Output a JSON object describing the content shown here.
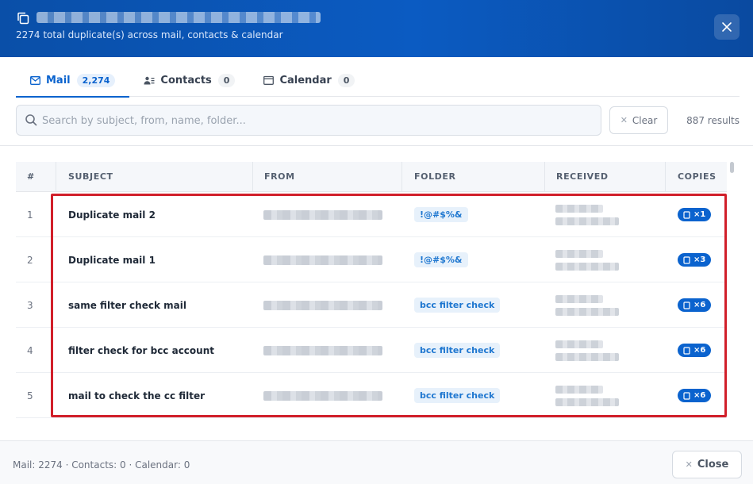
{
  "header": {
    "subtitle": "2274 total duplicate(s) across mail, contacts & calendar"
  },
  "tabs": [
    {
      "label": "Mail",
      "count": "2,274",
      "icon": "mail-icon"
    },
    {
      "label": "Contacts",
      "count": "0",
      "icon": "contacts-icon"
    },
    {
      "label": "Calendar",
      "count": "0",
      "icon": "calendar-icon"
    }
  ],
  "search": {
    "placeholder": "Search by subject, from, name, folder...",
    "value": "",
    "clear_label": "Clear",
    "results": "887 results"
  },
  "table": {
    "headers": [
      "#",
      "SUBJECT",
      "FROM",
      "FOLDER",
      "RECEIVED",
      "COPIES"
    ],
    "rows": [
      {
        "num": "1",
        "subject": "Duplicate mail 2",
        "folder": "!@#$%&",
        "copies": "×1"
      },
      {
        "num": "2",
        "subject": "Duplicate mail 1",
        "folder": "!@#$%&",
        "copies": "×3"
      },
      {
        "num": "3",
        "subject": "same filter check mail",
        "folder": "bcc filter check",
        "copies": "×6"
      },
      {
        "num": "4",
        "subject": "filter check for bcc account",
        "folder": "bcc filter check",
        "copies": "×6"
      },
      {
        "num": "5",
        "subject": "mail to check the cc filter",
        "folder": "bcc filter check",
        "copies": "×6"
      }
    ]
  },
  "footer": {
    "summary": "Mail: 2274 · Contacts: 0 · Calendar: 0",
    "close_label": "Close"
  },
  "colors": {
    "header_blue": "#0b5bc2",
    "accent": "#0b63ce",
    "highlight": "#d11f2a"
  }
}
